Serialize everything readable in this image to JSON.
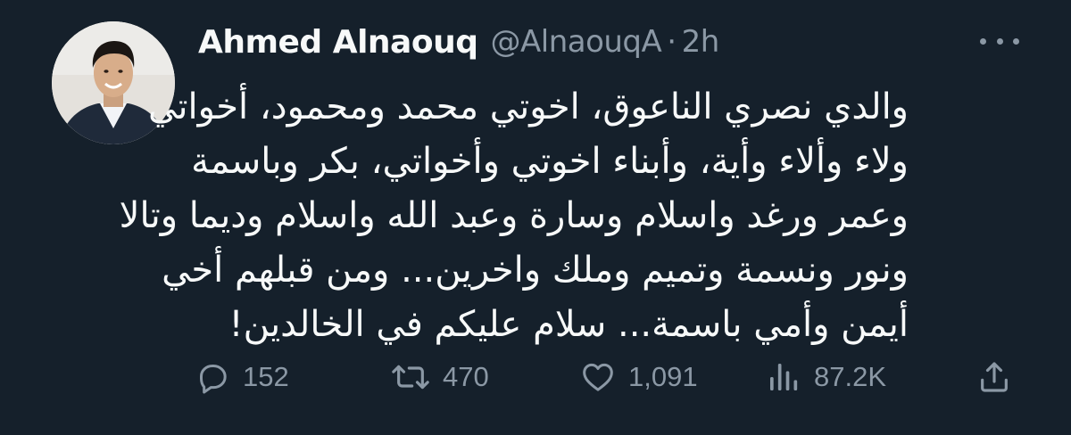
{
  "author": {
    "display_name": "Ahmed Alnaouq",
    "handle": "@AlnaouqA",
    "separator": "·",
    "timestamp": "2h",
    "avatar_icon": "avatar-photo"
  },
  "tweet": {
    "lines": [
      "والدي نصري الناعوق، اخوتي محمد ومحمود، أخواتي",
      "ولاء وألاء وأية، وأبناء اخوتي وأخواتي، بكر وباسمة",
      "وعمر ورغد واسلام وسارة وعبد الله واسلام وديما وتالا",
      "ونور ونسمة وتميم وملك واخرين... ومن قبلهم أخي",
      "أيمن وأمي باسمة... سلام عليكم في الخالدين!"
    ]
  },
  "actions": {
    "replies": "152",
    "retweets": "470",
    "likes": "1,091",
    "views": "87.2K",
    "icons": [
      "reply-icon",
      "retweet-icon",
      "like-icon",
      "views-icon",
      "share-icon"
    ]
  },
  "colors": {
    "background": "#15202b",
    "text_primary": "#f7f9f9",
    "text_secondary": "#8b98a5"
  }
}
